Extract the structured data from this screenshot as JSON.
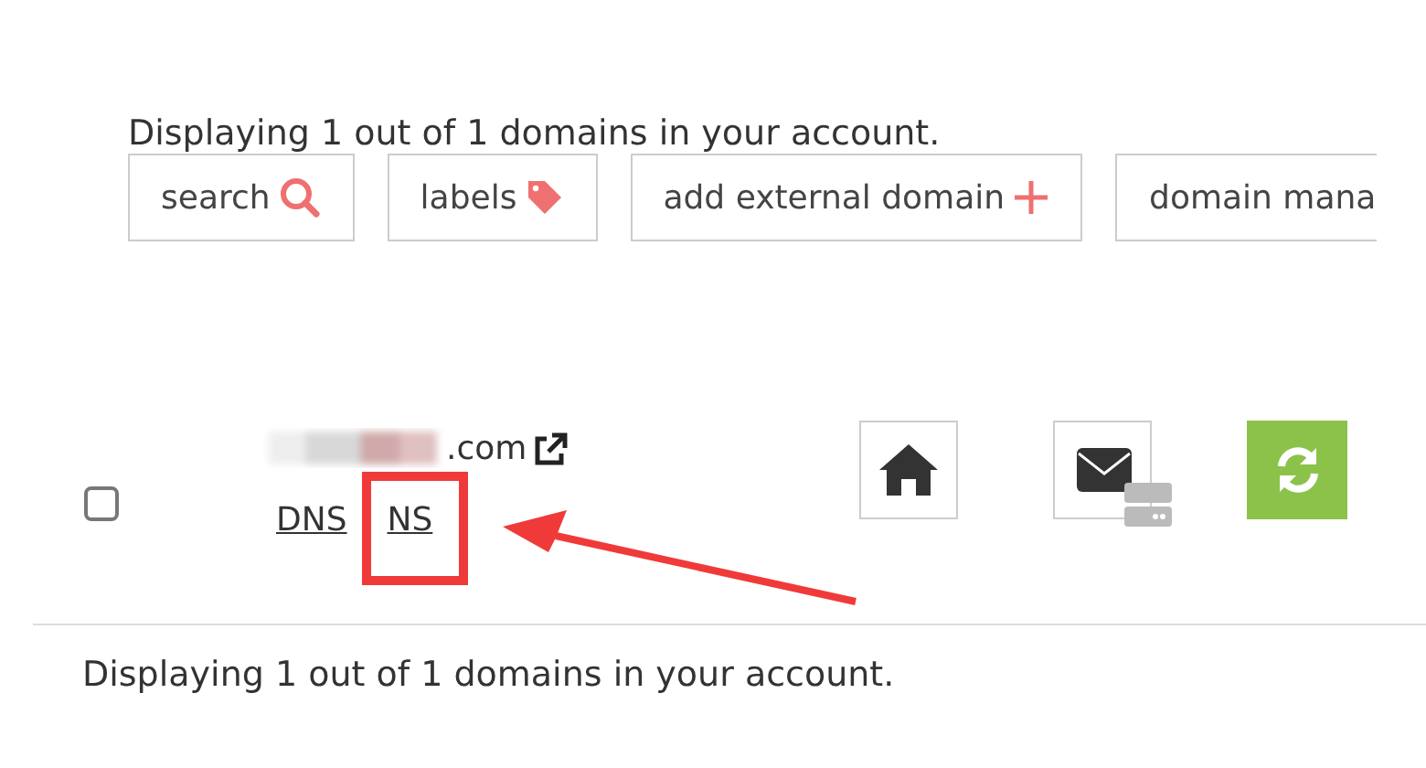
{
  "summary_top": "Displaying 1 out of 1 domains in your account.",
  "toolbar": [
    {
      "label": "search",
      "kind": "search"
    },
    {
      "label": "labels",
      "kind": "tag"
    },
    {
      "label": "add external domain",
      "kind": "plus"
    },
    {
      "label": "domain mana",
      "kind": "none"
    }
  ],
  "domain_row": {
    "checked": false,
    "domain_suffix": ".com",
    "links": [
      {
        "label": "DNS",
        "highlighted": false
      },
      {
        "label": "NS",
        "highlighted": true
      }
    ]
  },
  "summary_bottom": "Displaying 1 out of 1 domains in your account."
}
